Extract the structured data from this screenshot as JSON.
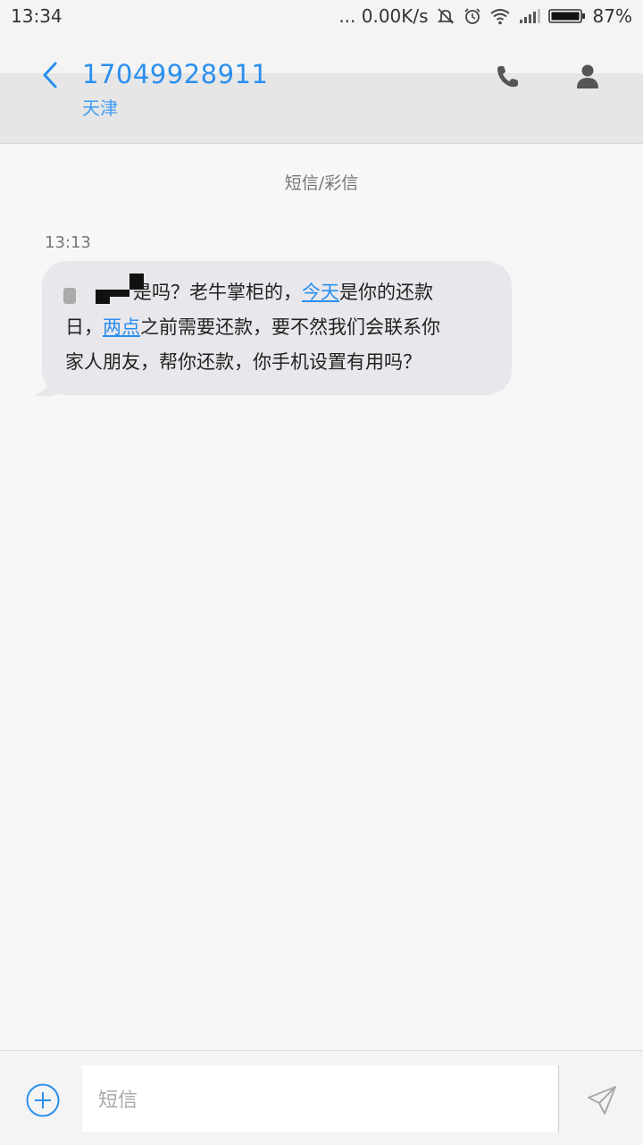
{
  "status_bar": {
    "time": "13:34",
    "network_speed": "... 0.00K/s",
    "battery_percent": "87%",
    "icons": [
      "mute-icon",
      "alarm-icon",
      "wifi-icon",
      "signal-icon",
      "battery-icon"
    ]
  },
  "header": {
    "contact_number": "17049928911",
    "contact_location": "天津",
    "icons": [
      "back-icon",
      "phone-icon",
      "person-icon"
    ],
    "accent_color": "#2b8ff0"
  },
  "thread": {
    "type_label": "短信/彩信",
    "messages": [
      {
        "time": "13:13",
        "segments": {
          "s1": "是吗？老牛掌柜的，",
          "link1": "今天",
          "s2": "是你的还款",
          "s3": "日，",
          "link2": "两点",
          "s4": "之前需要还款，要不然我们会联系你",
          "s5": "家人朋友，帮你还款，你手机设置有用吗？"
        }
      }
    ]
  },
  "composer": {
    "placeholder": "短信",
    "icons": [
      "add-icon",
      "send-icon"
    ]
  }
}
